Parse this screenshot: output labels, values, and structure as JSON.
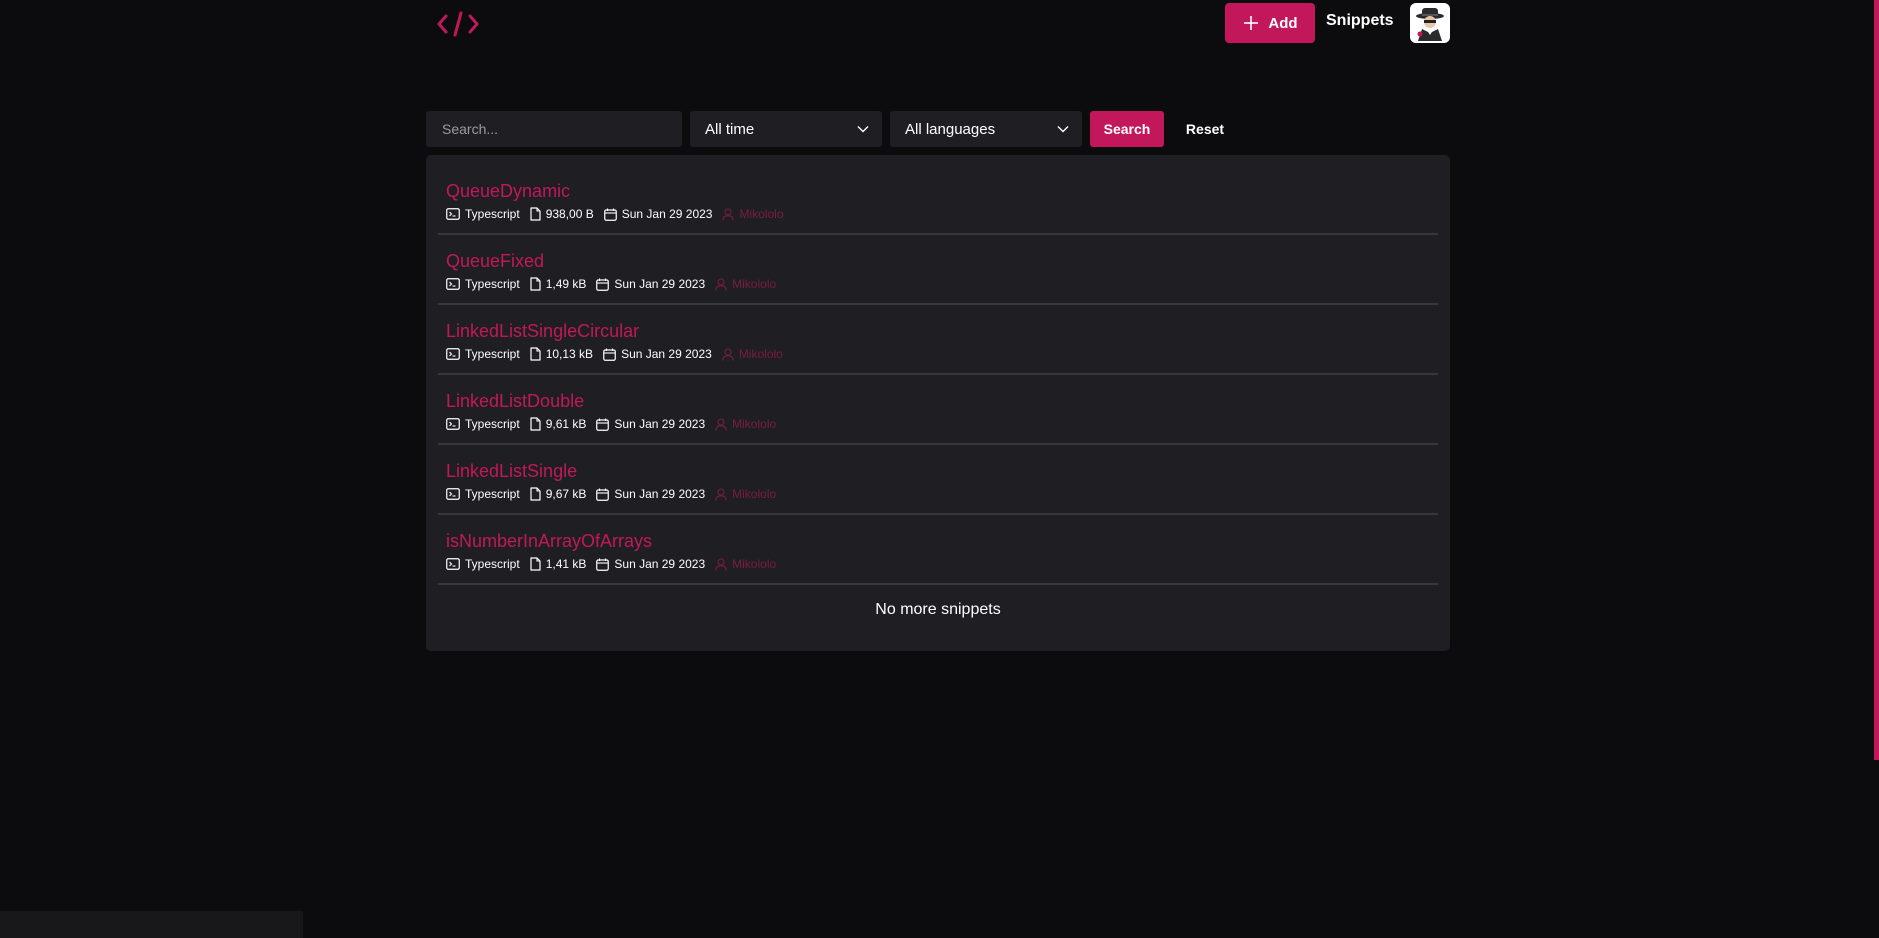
{
  "header": {
    "add_label": "Add",
    "nav_snippets": "Snippets"
  },
  "filters": {
    "search_placeholder": "Search...",
    "time_value": "All time",
    "language_value": "All languages",
    "search_label": "Search",
    "reset_label": "Reset"
  },
  "snippets": [
    {
      "title": "QueueDynamic",
      "language": "Typescript",
      "size": "938,00 B",
      "date": "Sun Jan 29 2023",
      "author": "Mikololo"
    },
    {
      "title": "QueueFixed",
      "language": "Typescript",
      "size": "1,49 kB",
      "date": "Sun Jan 29 2023",
      "author": "Mikololo"
    },
    {
      "title": "LinkedListSingleCircular",
      "language": "Typescript",
      "size": "10,13 kB",
      "date": "Sun Jan 29 2023",
      "author": "Mikololo"
    },
    {
      "title": "LinkedListDouble",
      "language": "Typescript",
      "size": "9,61 kB",
      "date": "Sun Jan 29 2023",
      "author": "Mikololo"
    },
    {
      "title": "LinkedListSingle",
      "language": "Typescript",
      "size": "9,67 kB",
      "date": "Sun Jan 29 2023",
      "author": "Mikololo"
    },
    {
      "title": "isNumberInArrayOfArrays",
      "language": "Typescript",
      "size": "1,41 kB",
      "date": "Sun Jan 29 2023",
      "author": "Mikololo"
    }
  ],
  "end_message": "No more snippets",
  "colors": {
    "accent": "#c2185b",
    "background": "#0c0c0e",
    "panel": "#1f1f23",
    "author_muted": "#7a1c40"
  },
  "icons": {
    "logo": "code-brackets-icon",
    "add": "plus-icon",
    "avatar": "spy-avatar-icon",
    "select_arrow": "chevron-down-icon",
    "language": "terminal-icon",
    "size": "file-icon",
    "date": "calendar-icon",
    "author": "user-icon"
  }
}
